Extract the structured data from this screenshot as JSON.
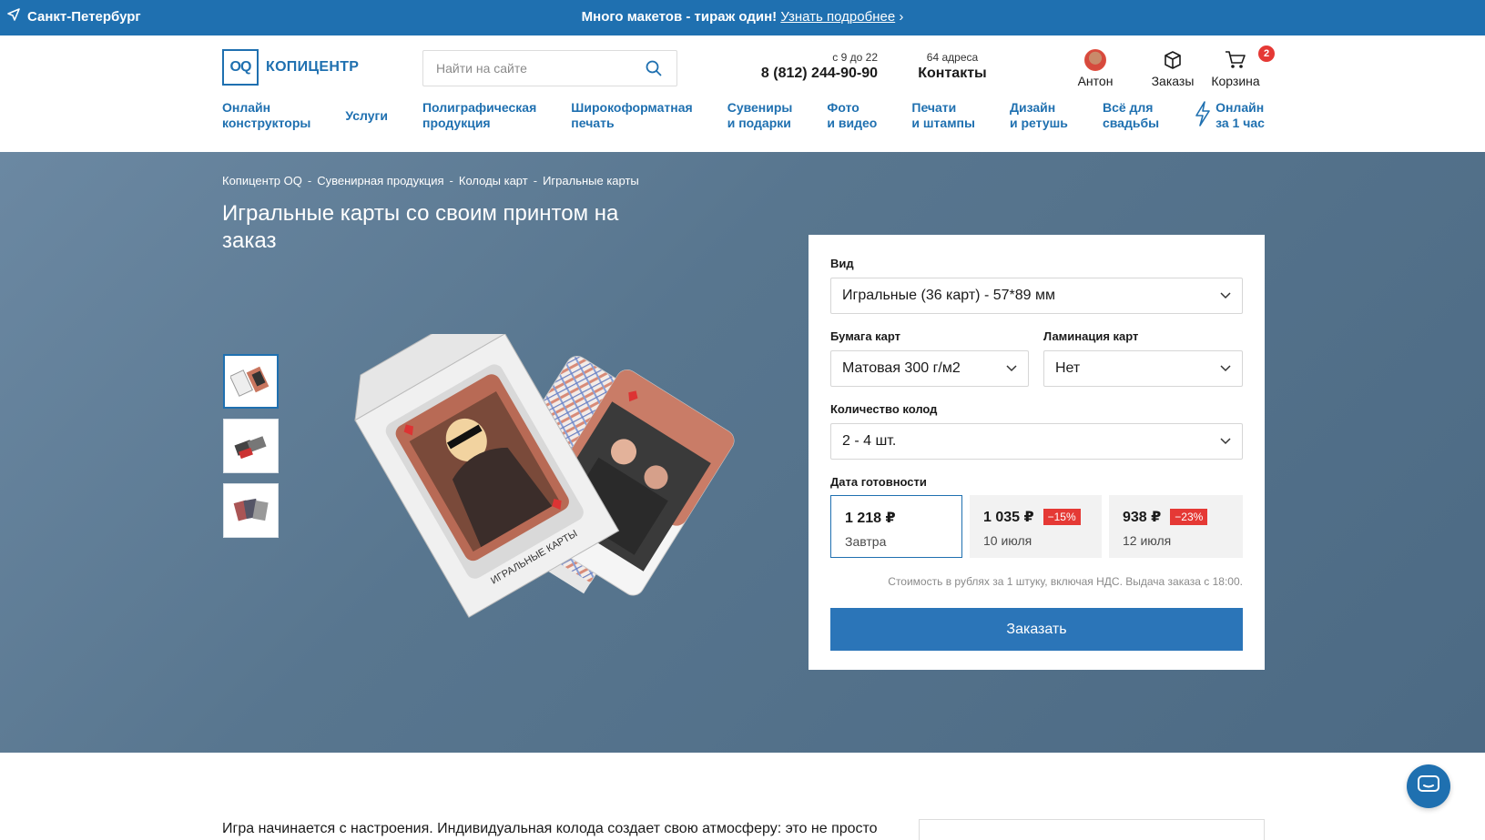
{
  "topbar": {
    "city": "Санкт-Петербург",
    "promo_lead": "Много макетов -",
    "promo_bold": "тираж один!",
    "promo_link": "Узнать подробнее",
    "promo_arrow": "›"
  },
  "header": {
    "logo_mark": "OQ",
    "logo_text": "КОПИЦЕНТР",
    "search_placeholder": "Найти на сайте",
    "hours": "с 9 до 22",
    "phone": "8 (812) 244-90-90",
    "addresses": "64 адреса",
    "contacts_label": "Контакты",
    "user_name": "Антон",
    "orders_label": "Заказы",
    "cart_label": "Корзина",
    "cart_count": "2"
  },
  "nav": [
    {
      "line1": "Онлайн",
      "line2": "конструкторы"
    },
    {
      "line1": "Услуги",
      "line2": ""
    },
    {
      "line1": "Полиграфическая",
      "line2": "продукция"
    },
    {
      "line1": "Широкоформатная",
      "line2": "печать"
    },
    {
      "line1": "Сувениры",
      "line2": "и подарки"
    },
    {
      "line1": "Фото",
      "line2": "и видео"
    },
    {
      "line1": "Печати",
      "line2": "и штампы"
    },
    {
      "line1": "Дизайн",
      "line2": "и ретушь"
    },
    {
      "line1": "Всё для",
      "line2": "свадьбы"
    },
    {
      "line1": "Онлайн",
      "line2": "за 1 час"
    }
  ],
  "breadcrumbs": [
    "Копицентр OQ",
    "Сувенирная продукция",
    "Колоды карт",
    "Игральные карты"
  ],
  "breadcrumb_sep": "-",
  "page_title": "Игральные карты со своим принтом на заказ",
  "product_box_text": "ИГРАЛЬНЫЕ КАРТЫ",
  "form": {
    "type_label": "Вид",
    "type_value": "Игральные (36 карт) - 57*89 мм",
    "paper_label": "Бумага карт",
    "paper_value": "Матовая 300 г/м2",
    "lamination_label": "Ламинация карт",
    "lamination_value": "Нет",
    "quantity_label": "Количество колод",
    "quantity_value": "2 - 4 шт.",
    "date_label": "Дата готовности",
    "options": [
      {
        "price": "1 218 ₽",
        "date": "Завтра",
        "discount": ""
      },
      {
        "price": "1 035 ₽",
        "date": "10 июля",
        "discount": "−15%"
      },
      {
        "price": "938 ₽",
        "date": "12 июля",
        "discount": "−23%"
      }
    ],
    "note": "Стоимость в рублях за 1 штуку, включая НДС. Выдача заказа с 18:00.",
    "order_button": "Заказать"
  },
  "intro_text": "Игра начинается с настроения. Индивидуальная колода создает свою атмосферу: это не просто",
  "colors": {
    "brand": "#1f70b0",
    "discount": "#e53935"
  }
}
